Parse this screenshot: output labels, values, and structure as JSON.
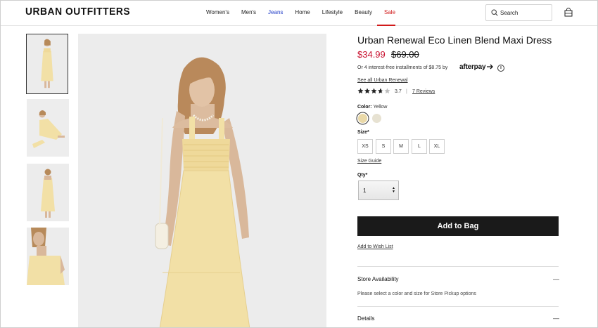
{
  "brand": "URBAN OUTFITTERS",
  "nav": {
    "items": [
      {
        "label": "Women's",
        "color": "#222222"
      },
      {
        "label": "Men's",
        "color": "#222222"
      },
      {
        "label": "Jeans",
        "color": "#2540c9"
      },
      {
        "label": "Home",
        "color": "#222222"
      },
      {
        "label": "Lifestyle",
        "color": "#222222"
      },
      {
        "label": "Beauty",
        "color": "#222222"
      },
      {
        "label": "Sale",
        "color": "#d11a1a"
      }
    ]
  },
  "search": {
    "placeholder": "Search",
    "icon": "search-icon"
  },
  "header_icons": {
    "bag": "shopping-bag-icon"
  },
  "product": {
    "title": "Urban Renewal Eco Linen Blend Maxi Dress",
    "sale_price": "$34.99",
    "original_price": "$69.00",
    "installments_text": "Or 4 interest-free installments of $8.75 by",
    "afterpay_label": "afterpay",
    "info_glyph": "i",
    "see_all_link": "See all Urban Renewal",
    "rating_value": 3.7,
    "rating_text": "3.7",
    "rating_separator": "|",
    "reviews_link": "7 Reviews",
    "color_label": "Color:",
    "color_value": "Yellow",
    "swatches": [
      {
        "name": "Yellow",
        "hex": "#ead9a8",
        "selected": true
      },
      {
        "name": "Cream",
        "hex": "#e7e2d2",
        "selected": false
      }
    ],
    "size_label": "Size*",
    "sizes": [
      "XS",
      "S",
      "M",
      "L",
      "XL"
    ],
    "size_guide_link": "Size Guide",
    "qty_label": "Qty*",
    "qty_value": "1",
    "qty_arrows": "▲▼",
    "add_to_bag": "Add to Bag",
    "wish_list_link": "Add to Wish List",
    "accordions": [
      {
        "title": "Store Availability",
        "toggle": "—",
        "body": "Please select a color and size for Store Pickup options"
      },
      {
        "title": "Details",
        "toggle": "—",
        "body": ""
      }
    ]
  },
  "colors": {
    "sale_red": "#c8102e",
    "button_black": "#1a1a1a",
    "dress_yellow": "#f2e0a6",
    "background_gray": "#ececec"
  }
}
